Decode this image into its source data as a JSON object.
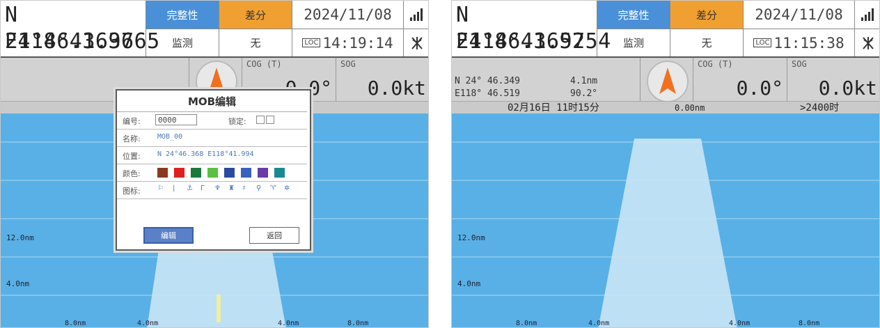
{
  "screens": [
    {
      "lat": "N 24°46.3636",
      "lon": "E118°41.9765",
      "integrity_label": "完整性",
      "diff_label": "差分",
      "monitor_label": "监测",
      "none_label": "无",
      "date": "2024/11/08",
      "time": "14:19:14",
      "loc_badge": "LOC",
      "cog_label": "COG (T)",
      "cog_value": "0.0°",
      "sog_label": "SOG",
      "sog_value": "0.0kt",
      "range_upper": "12.0nm",
      "range_lower": "4.0nm",
      "bottom_labels": [
        "8.0nm",
        "4.0nm",
        "4.0nm",
        "8.0nm"
      ]
    },
    {
      "lat": "N 24°46.3652",
      "lon": "E118°41.9754",
      "integrity_label": "完整性",
      "diff_label": "差分",
      "monitor_label": "监测",
      "none_label": "无",
      "date": "2024/11/08",
      "time": "11:15:38",
      "loc_badge": "LOC",
      "cog_label": "COG (T)",
      "cog_value": "0.0°",
      "sog_label": "SOG",
      "sog_value": "0.0kt",
      "wp_lat": "N 24° 46.349",
      "wp_lon": "E118° 46.519",
      "wp_dist": "4.1nm",
      "wp_bearing": "90.2°",
      "eta": "02月16日 11时15分",
      "xte": "0.00nm",
      "ttg": ">2400时",
      "range_upper": "12.0nm",
      "range_lower": "4.0nm",
      "bottom_labels": [
        "8.0nm",
        "4.0nm",
        "4.0nm",
        "8.0nm"
      ]
    }
  ],
  "dialog": {
    "title": "MOB编辑",
    "number_label": "编号:",
    "number_value": "0000",
    "lock_label": "锁定:",
    "name_label": "名称:",
    "name_value": "MOB_00",
    "position_label": "位置:",
    "position_value": "N 24°46.368 E118°41.994",
    "color_label": "颜色:",
    "colors": [
      "#8b3a1e",
      "#e02020",
      "#1a7a3a",
      "#5ac040",
      "#2a4aa0",
      "#3a60c0",
      "#6a3aa8",
      "#1a8a90"
    ],
    "icon_label": "图标:",
    "edit_button": "编辑",
    "return_button": "返回"
  }
}
